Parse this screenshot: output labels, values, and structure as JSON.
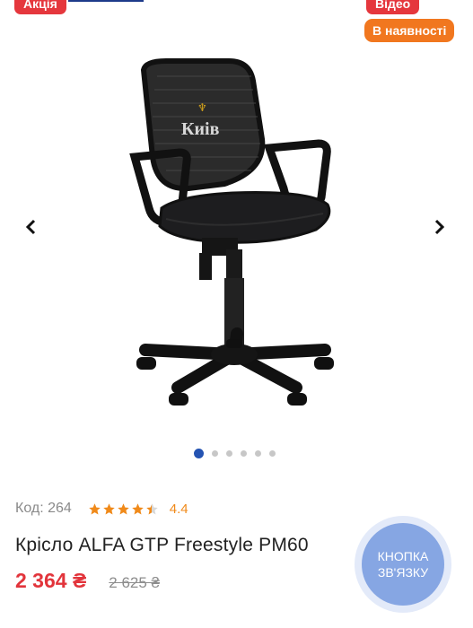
{
  "badges": {
    "sale": "Акція",
    "video": "Відео",
    "in_stock": "В наявності"
  },
  "image": {
    "subject": "office chair",
    "back_logo_text": "Киів"
  },
  "carousel": {
    "slides": 6,
    "active": 1
  },
  "product": {
    "code_label": "Код: 264",
    "rating": "4.4",
    "stars": 4.4,
    "title": "Крісло ALFA GTP Freestyle PM60",
    "price": "2 364 ₴",
    "old_price": "2 625 ₴"
  },
  "contact": {
    "line1": "КНОПКА",
    "line2": "ЗВ'ЯЗКУ"
  },
  "colors": {
    "accent_red": "#e5373d",
    "orange": "#f1771f",
    "blue": "#2453b2",
    "star": "#f08a1a"
  },
  "icons": [
    "chevron-left-icon",
    "chevron-right-icon",
    "star-icon"
  ]
}
